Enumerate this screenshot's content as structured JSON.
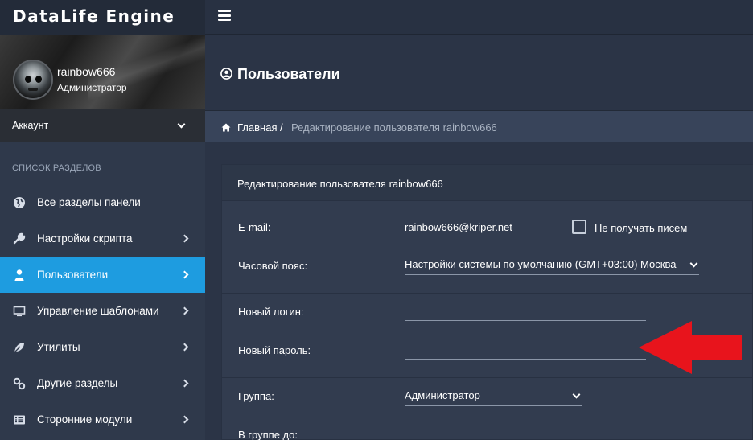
{
  "app": {
    "title": "DataLife Engine"
  },
  "user": {
    "name": "rainbow666",
    "role": "Администратор",
    "account_label": "Аккаунт"
  },
  "sidebar": {
    "section_title": "СПИСОК РАЗДЕЛОВ",
    "items": [
      {
        "label": "Все разделы панели",
        "icon": "globe-icon"
      },
      {
        "label": "Настройки скрипта",
        "icon": "wrench-icon"
      },
      {
        "label": "Пользователи",
        "icon": "user-icon"
      },
      {
        "label": "Управление шаблонами",
        "icon": "monitor-icon"
      },
      {
        "label": "Утилиты",
        "icon": "leaf-icon"
      },
      {
        "label": "Другие разделы",
        "icon": "link-icon"
      },
      {
        "label": "Сторонние модули",
        "icon": "list-icon"
      }
    ],
    "active_index": 2
  },
  "page": {
    "title": "Пользователи"
  },
  "breadcrumb": {
    "home": "Главная",
    "separator": "/",
    "current": "Редактирование пользователя rainbow666"
  },
  "card": {
    "title": "Редактирование пользователя rainbow666",
    "email": {
      "label": "E-mail:",
      "value": "rainbow666@kriper.net"
    },
    "no_mail": {
      "label": "Не получать писем"
    },
    "timezone": {
      "label": "Часовой пояс:",
      "value": "Настройки системы по умолчанию (GMT+03:00) Москва"
    },
    "new_login": {
      "label": "Новый логин:",
      "value": ""
    },
    "new_password": {
      "label": "Новый пароль:",
      "value": ""
    },
    "group": {
      "label": "Группа:",
      "value": "Администратор"
    },
    "group_until": {
      "label": "В группе до:"
    }
  },
  "colors": {
    "accent": "#1e9ce0",
    "annotation_arrow": "#e8141c",
    "background": "#2b3446"
  }
}
